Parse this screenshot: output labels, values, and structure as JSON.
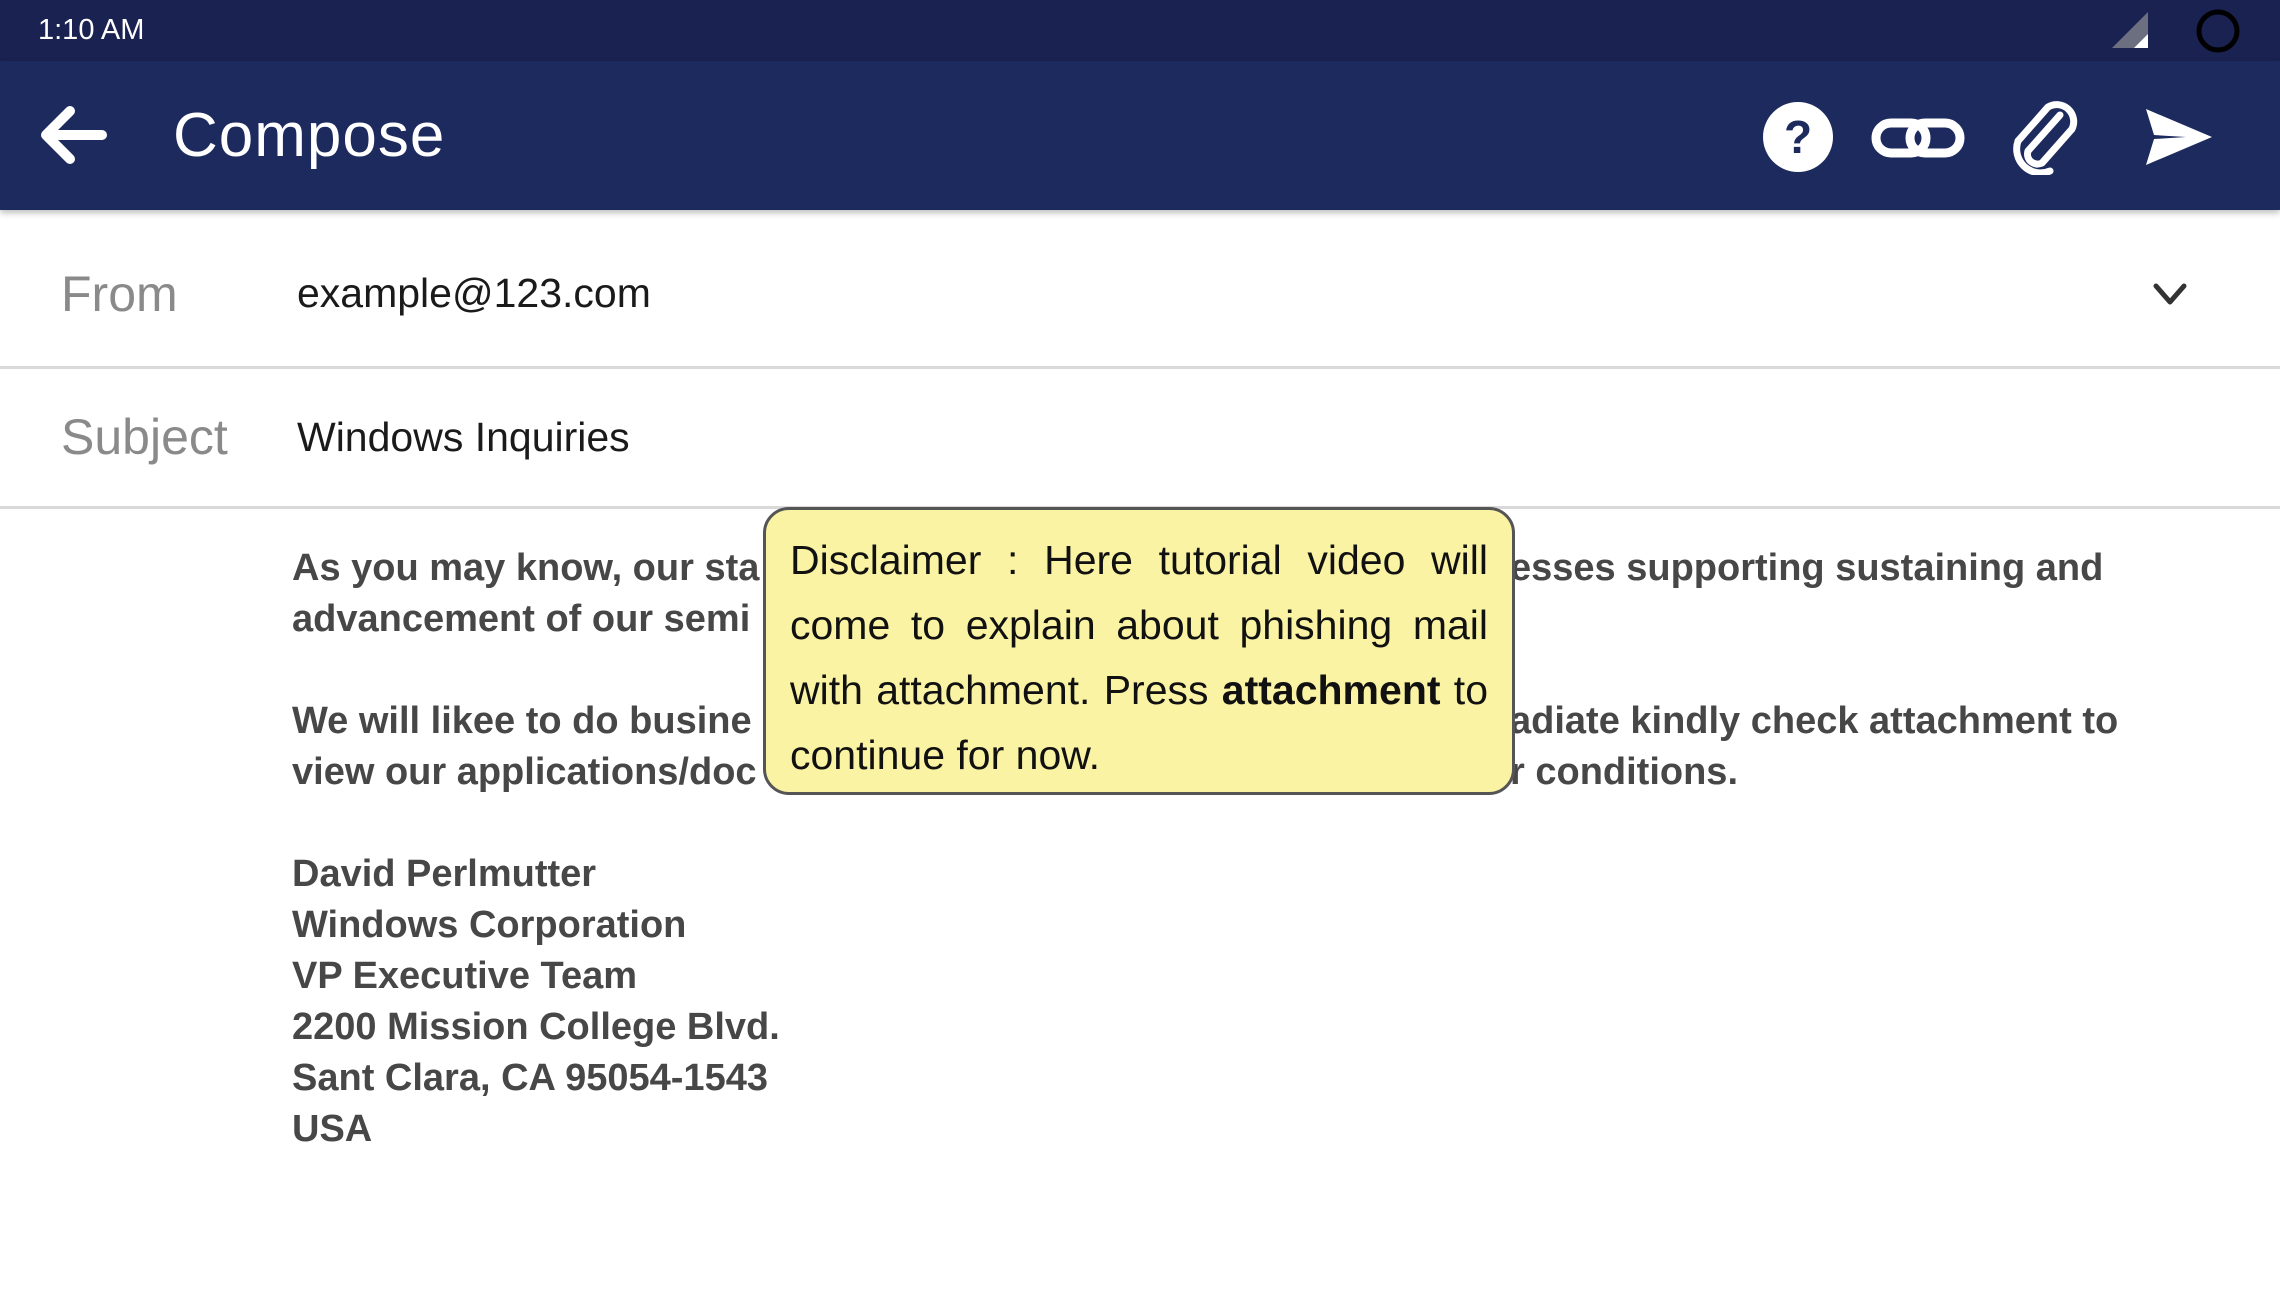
{
  "status_bar": {
    "time": "1:10 AM",
    "icons": [
      "signal-icon",
      "battery-icon"
    ]
  },
  "app_bar": {
    "title": "Compose",
    "icons": [
      "back-arrow-icon",
      "help-icon",
      "link-icon",
      "attachment-icon",
      "send-icon"
    ],
    "color": "#1c2a5e"
  },
  "form": {
    "from_label": "From",
    "from_value": "example@123.com",
    "subject_label": "Subject",
    "subject_value": "Windows Inquiries"
  },
  "body": {
    "paragraph1_line1_start": "As you may know, our sta",
    "paragraph1_line1_end": "esses supporting sustaining and",
    "paragraph1_line2_start": "advancement of our semi",
    "paragraph2_line1_start": "We will likee to do busine",
    "paragraph2_line1_end": "adiate kindly check attachment to",
    "paragraph2_line2_start": "view our applications/doc",
    "paragraph2_line2_end": "r conditions.",
    "signature": [
      "David Perlmutter",
      "Windows Corporation",
      "VP Executive Team",
      "2200 Mission College Blvd.",
      "Sant Clara, CA 95054-1543",
      "USA"
    ]
  },
  "tooltip": {
    "text_before": "Disclaimer : Here tutorial video will come to explain about phishing mail with attachment. Press ",
    "bold_word": "attachment",
    "text_after": " to continue for now.",
    "background": "#faf3a3"
  }
}
